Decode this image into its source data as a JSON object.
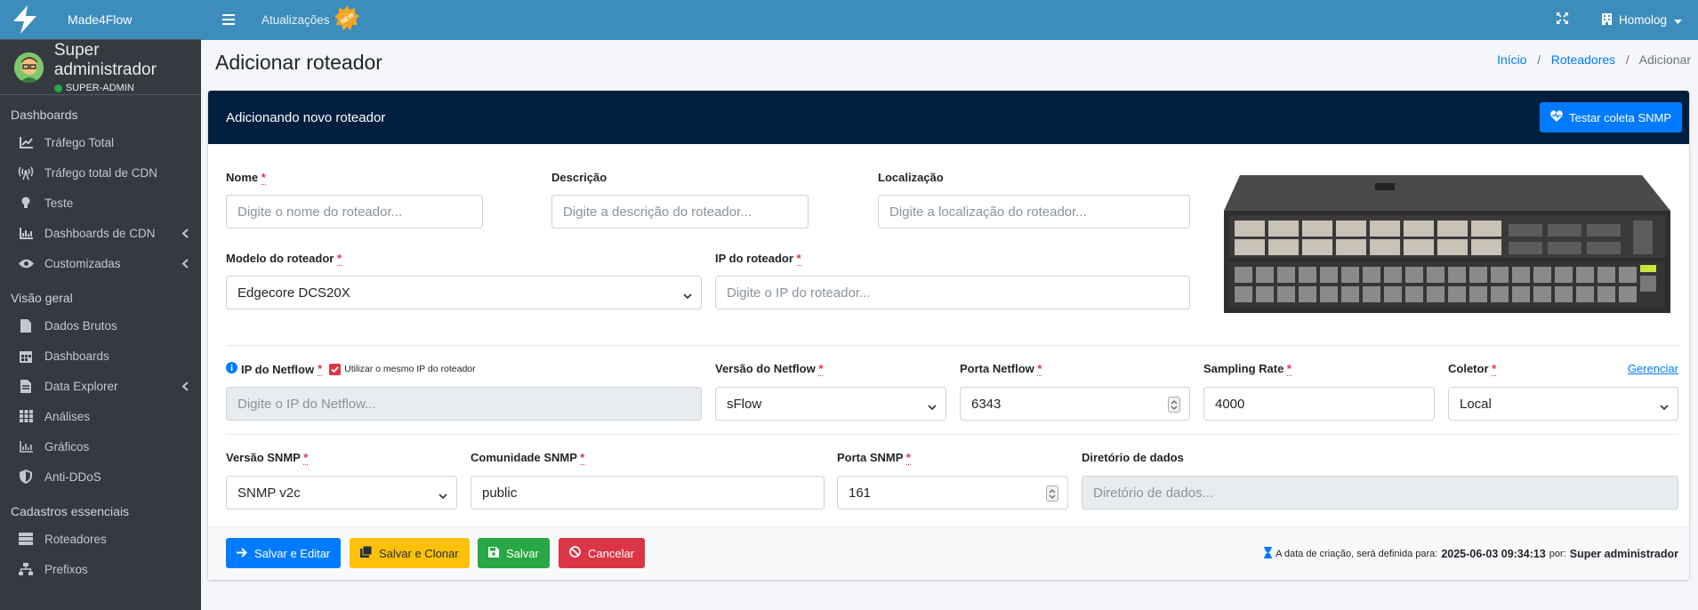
{
  "brand": {
    "name": "Made4Flow"
  },
  "user": {
    "name": "Super administrador",
    "role": "SUPER-ADMIN"
  },
  "sidebar": {
    "sections": [
      {
        "header": "Dashboards"
      },
      {
        "header": "Visão geral"
      },
      {
        "header": "Cadastros essenciais"
      }
    ],
    "items": [
      {
        "label": "Tráfego Total",
        "icon": "chart-line-icon"
      },
      {
        "label": "Tráfego total de CDN",
        "icon": "broadcast-tower-icon"
      },
      {
        "label": "Teste",
        "icon": "lightbulb-icon"
      },
      {
        "label": "Dashboards de CDN",
        "icon": "chart-area-icon"
      },
      {
        "label": "Customizadas",
        "icon": "eye-icon"
      },
      {
        "label": "Dados Brutos",
        "icon": "file-icon"
      },
      {
        "label": "Dashboards",
        "icon": "calendar-icon"
      },
      {
        "label": "Data Explorer",
        "icon": "file-alt-icon"
      },
      {
        "label": "Análises",
        "icon": "th-icon"
      },
      {
        "label": "Gráficos",
        "icon": "chart-bar-icon"
      },
      {
        "label": "Anti-DDoS",
        "icon": "shield-icon"
      },
      {
        "label": "Roteadores",
        "icon": "server-icon"
      },
      {
        "label": "Prefixos",
        "icon": "sitemap-icon"
      }
    ]
  },
  "topbar": {
    "updates": "Atualizações",
    "badge": "NEW",
    "environment": "Homolog"
  },
  "page": {
    "title": "Adicionar roteador",
    "breadcrumb": [
      "Início",
      "Roteadores",
      "Adicionar"
    ]
  },
  "card": {
    "title": "Adicionando novo roteador",
    "snmp_test": "Testar coleta SNMP"
  },
  "form": {
    "name": {
      "label": "Nome",
      "placeholder": "Digite o nome do roteador..."
    },
    "description": {
      "label": "Descrição",
      "placeholder": "Digite a descrição do roteador..."
    },
    "location": {
      "label": "Localização",
      "placeholder": "Digite a localização do roteador..."
    },
    "model": {
      "label": "Modelo do roteador",
      "value": "Edgecore DCS20X"
    },
    "ip": {
      "label": "IP do roteador",
      "placeholder": "Digite o IP do roteador..."
    },
    "netflow_ip": {
      "label": "IP do Netflow",
      "checkbox": "Utilizar o mesmo IP do roteador",
      "placeholder": "Digite o IP do Netflow..."
    },
    "netflow_version": {
      "label": "Versão do Netflow",
      "value": "sFlow"
    },
    "netflow_port": {
      "label": "Porta Netflow",
      "value": "6343"
    },
    "sampling": {
      "label": "Sampling Rate",
      "value": "4000"
    },
    "collector": {
      "label": "Coletor",
      "value": "Local",
      "manage": "Gerenciar"
    },
    "snmp_version": {
      "label": "Versão SNMP",
      "value": "SNMP v2c"
    },
    "snmp_community": {
      "label": "Comunidade SNMP",
      "value": "public"
    },
    "snmp_port": {
      "label": "Porta SNMP",
      "value": "161"
    },
    "data_dir": {
      "label": "Diretório de dados",
      "placeholder": "Diretório de dados..."
    }
  },
  "actions": {
    "save_edit": "Salvar e Editar",
    "save_clone": "Salvar e Clonar",
    "save": "Salvar",
    "cancel": "Cancelar"
  },
  "meta": {
    "text": "A data de criação, será definida para:",
    "datetime": "2025-06-03 09:34:13",
    "by": "por:",
    "author": "Super administrador"
  },
  "colors": {
    "primary": "#007bff",
    "warning": "#ffc107",
    "success": "#28a745",
    "danger": "#dc3545",
    "navy": "#001f3f",
    "topbar": "#3c8dbc",
    "sidebar": "#343a40"
  }
}
